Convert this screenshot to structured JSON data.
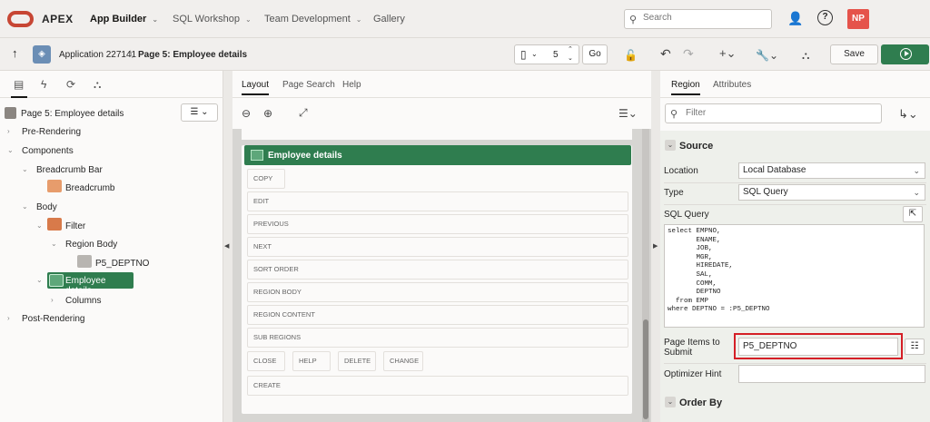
{
  "header": {
    "brand": "APEX",
    "nav": [
      {
        "label": "App Builder"
      },
      {
        "label": "SQL Workshop"
      },
      {
        "label": "Team Development"
      },
      {
        "label": "Gallery"
      }
    ],
    "search_placeholder": "Search",
    "avatar_initials": "NP"
  },
  "toolbar": {
    "application": "Application 227141",
    "page": "Page 5: Employee details",
    "page_number": "5",
    "go_label": "Go",
    "save_label": "Save"
  },
  "left": {
    "page_selector": "Page 5: Employee details",
    "tree": {
      "pre_rendering": "Pre-Rendering",
      "components": "Components",
      "breadcrumb_bar": "Breadcrumb Bar",
      "breadcrumb": "Breadcrumb",
      "body": "Body",
      "filter": "Filter",
      "region_body": "Region Body",
      "p5_deptno": "P5_DEPTNO",
      "employee_details": "Employee details",
      "columns": "Columns",
      "post_rendering": "Post-Rendering"
    }
  },
  "middle": {
    "tabs": [
      "Layout",
      "Page Search",
      "Help"
    ],
    "region_title": "Employee details",
    "slots": {
      "copy": "COPY",
      "edit": "EDIT",
      "previous": "PREVIOUS",
      "next": "NEXT",
      "sort_order": "SORT ORDER",
      "region_body": "REGION BODY",
      "region_content": "REGION CONTENT",
      "sub_regions": "SUB REGIONS",
      "close": "CLOSE",
      "help": "HELP",
      "delete": "DELETE",
      "change": "CHANGE",
      "create": "CREATE"
    }
  },
  "right": {
    "tabs": [
      "Region",
      "Attributes"
    ],
    "filter_placeholder": "Filter",
    "source_header": "Source",
    "location_label": "Location",
    "location_value": "Local Database",
    "type_label": "Type",
    "type_value": "SQL Query",
    "sql_label": "SQL Query",
    "sql_text": "select EMPNO,\n       ENAME,\n       JOB,\n       MGR,\n       HIREDATE,\n       SAL,\n       COMM,\n       DEPTNO\n  from EMP\nwhere DEPTNO = :P5_DEPTNO",
    "items_submit_label": "Page Items to Submit",
    "items_submit_value": "P5_DEPTNO",
    "optimizer_label": "Optimizer Hint",
    "order_by_header": "Order By"
  },
  "colors": {
    "accent_green": "#2f7d4f",
    "oracle_red": "#c74634",
    "highlight_red": "#d51f26",
    "avatar_bg": "#e5534b"
  }
}
